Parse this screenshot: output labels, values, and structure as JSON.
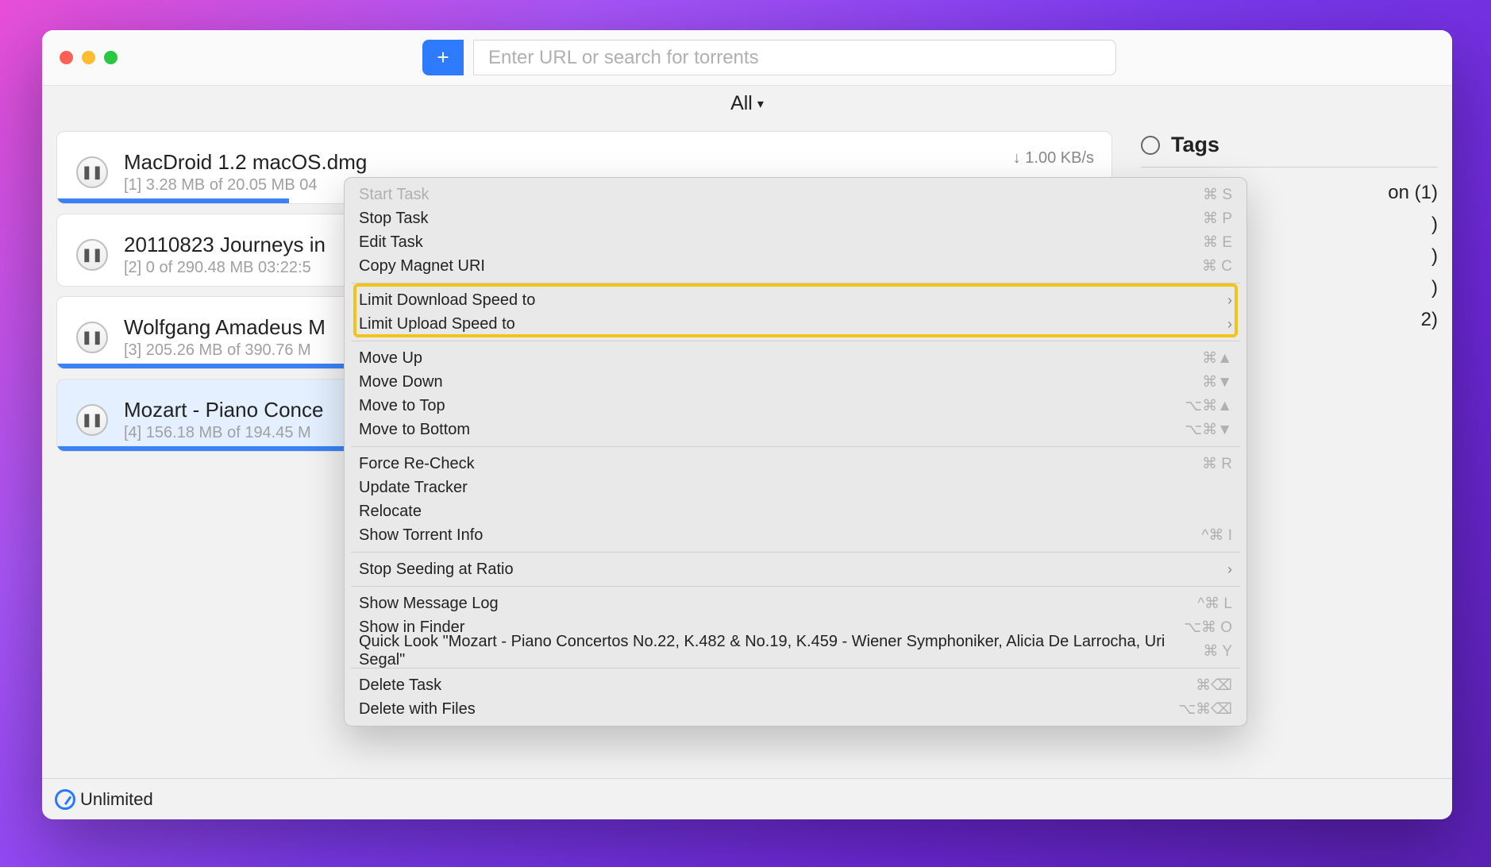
{
  "search": {
    "placeholder": "Enter URL or search for torrents"
  },
  "filter": {
    "label": "All"
  },
  "tasks": [
    {
      "title": "MacDroid 1.2 macOS.dmg",
      "sub": "[1] 3.28 MB of 20.05 MB 04",
      "right": "↓ 1.00 KB/s",
      "prog": 22,
      "selected": false
    },
    {
      "title": "20110823 Journeys in",
      "sub": "[2] 0 of 290.48 MB 03:22:5",
      "right": "",
      "prog": 0,
      "selected": false
    },
    {
      "title": "Wolfgang Amadeus M",
      "sub": "[3] 205.26 MB of 390.76 M",
      "right": "",
      "prog": 52,
      "selected": false
    },
    {
      "title": "Mozart - Piano Conce",
      "sub": "[4] 156.18 MB of 194.45 M",
      "right": "",
      "prog": 80,
      "selected": true
    }
  ],
  "tags": {
    "header": "Tags",
    "items": [
      "on (1)",
      ")",
      ")",
      ")",
      "2)"
    ]
  },
  "footer": {
    "speed": "Unlimited"
  },
  "ctx": {
    "groups": [
      [
        {
          "label": "Start Task",
          "short": "⌘ S",
          "disabled": true
        },
        {
          "label": "Stop Task",
          "short": "⌘ P"
        },
        {
          "label": "Edit Task",
          "short": "⌘ E"
        },
        {
          "label": "Copy Magnet URI",
          "short": "⌘ C"
        }
      ],
      [
        {
          "label": "Limit Download Speed to",
          "submenu": true
        },
        {
          "label": "Limit Upload Speed to",
          "submenu": true
        }
      ],
      [
        {
          "label": "Move Up",
          "short": "⌘▲"
        },
        {
          "label": "Move Down",
          "short": "⌘▼"
        },
        {
          "label": "Move to Top",
          "short": "⌥⌘▲"
        },
        {
          "label": "Move to Bottom",
          "short": "⌥⌘▼"
        }
      ],
      [
        {
          "label": "Force Re-Check",
          "short": "⌘ R"
        },
        {
          "label": "Update Tracker"
        },
        {
          "label": "Relocate"
        },
        {
          "label": "Show Torrent Info",
          "short": "^⌘ I"
        }
      ],
      [
        {
          "label": "Stop Seeding at Ratio",
          "submenu": true
        }
      ],
      [
        {
          "label": "Show Message Log",
          "short": "^⌘ L"
        },
        {
          "label": "Show in Finder",
          "short": "⌥⌘ O"
        },
        {
          "label": "Quick Look \"Mozart - Piano Concertos No.22, K.482 & No.19, K.459 - Wiener Symphoniker, Alicia De Larrocha, Uri Segal\"",
          "short": "⌘ Y"
        }
      ],
      [
        {
          "label": "Delete Task",
          "short": "⌘⌫"
        },
        {
          "label": "Delete with Files",
          "short": "⌥⌘⌫"
        }
      ]
    ]
  }
}
